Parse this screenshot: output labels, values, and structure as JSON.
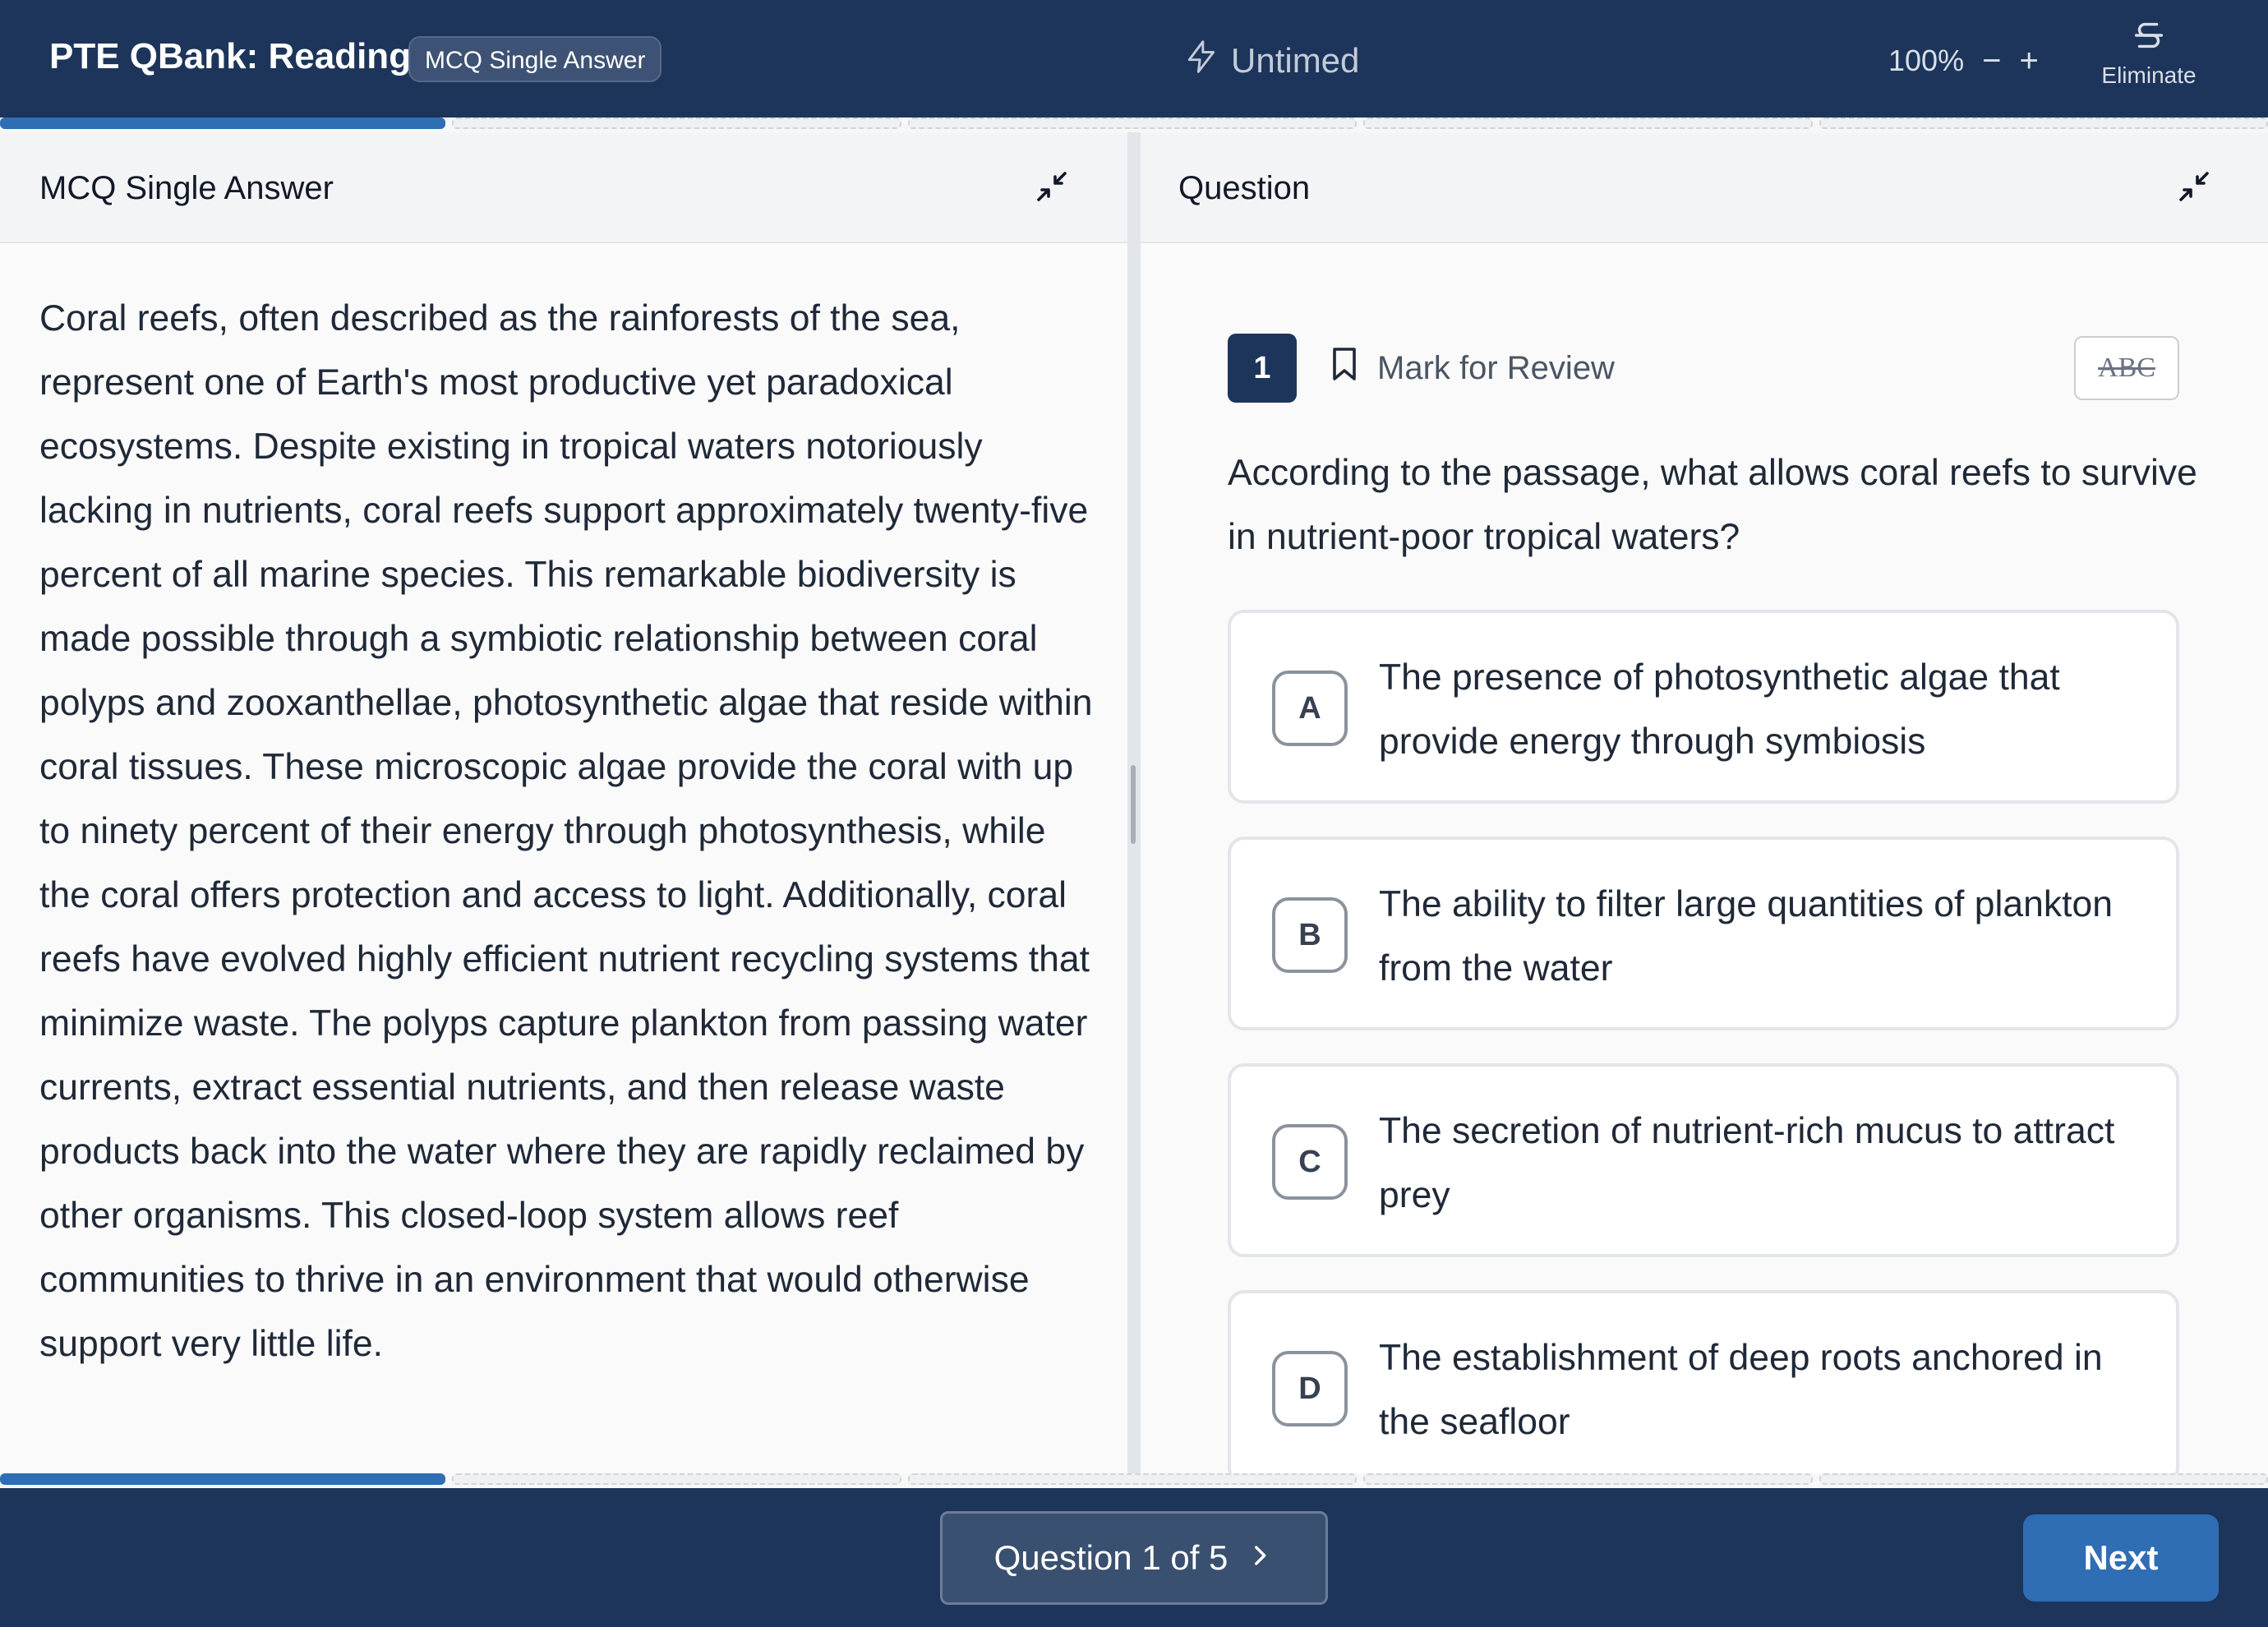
{
  "header": {
    "app_title": "PTE QBank: Reading",
    "type_badge": "MCQ Single Answer",
    "timer_label": "Untimed",
    "zoom_level": "100%",
    "zoom_out": "−",
    "zoom_in": "+",
    "eliminate_label": "Eliminate"
  },
  "progress": {
    "total_segments": 5,
    "current_segment": 1
  },
  "passage_panel": {
    "title": "MCQ Single Answer",
    "text": "Coral reefs, often described as the rainforests of the sea, represent one of Earth's most productive yet paradoxical ecosystems. Despite existing in tropical waters notoriously lacking in nutrients, coral reefs support approximately twenty-five percent of all marine species. This remarkable biodiversity is made possible through a symbiotic relationship between coral polyps and zooxanthellae, photosynthetic algae that reside within coral tissues. These microscopic algae provide the coral with up to ninety percent of their energy through photosynthesis, while the coral offers protection and access to light. Additionally, coral reefs have evolved highly efficient nutrient recycling systems that minimize waste. The polyps capture plankton from passing water currents, extract essential nutrients, and then release waste products back into the water where they are rapidly reclaimed by other organisms. This closed-loop system allows reef communities to thrive in an environment that would otherwise support very little life."
  },
  "question_panel": {
    "title": "Question",
    "question_number": "1",
    "mark_for_review": "Mark for Review",
    "strike_button": "ABC",
    "question_text": "According to the passage, what allows coral reefs to survive in nutrient-poor tropical waters?",
    "options": [
      {
        "letter": "A",
        "text": "The presence of photosynthetic algae that provide energy through symbiosis"
      },
      {
        "letter": "B",
        "text": "The ability to filter large quantities of plankton from the water"
      },
      {
        "letter": "C",
        "text": "The secretion of nutrient-rich mucus to attract prey"
      },
      {
        "letter": "D",
        "text": "The establishment of deep roots anchored in the seafloor"
      }
    ]
  },
  "footer": {
    "question_nav": "Question 1 of 5",
    "next_label": "Next"
  },
  "colors": {
    "header_bg": "#1d355a",
    "accent_blue": "#2f6db5",
    "panel_bg": "#fafafa"
  },
  "icons": {
    "timer": "lightning-icon",
    "eliminate": "strikethrough-s-icon",
    "collapse": "collapse-arrows-icon",
    "bookmark": "bookmark-icon",
    "chevron": "chevron-right-icon"
  }
}
